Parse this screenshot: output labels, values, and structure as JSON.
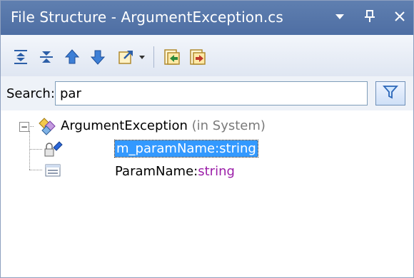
{
  "window": {
    "title": "File Structure - ArgumentException.cs",
    "controls": {
      "dropdown": "▾",
      "pin": "⊥",
      "close": "×"
    }
  },
  "toolbar": {
    "buttons": [
      {
        "name": "collapse-all-icon"
      },
      {
        "name": "expand-all-icon"
      },
      {
        "name": "move-up-icon"
      },
      {
        "name": "move-down-icon"
      },
      {
        "name": "navigate-icon"
      },
      {
        "name": "import-icon"
      },
      {
        "name": "export-icon"
      }
    ]
  },
  "search": {
    "label": "Search:",
    "value": "par"
  },
  "tree": {
    "root": {
      "name": "ArgumentException",
      "suffix": "(in System)"
    },
    "children": [
      {
        "name": "m_paramName",
        "sep": ":",
        "type": "string",
        "selected": true
      },
      {
        "name": "ParamName",
        "sep": ":",
        "type": "string",
        "selected": false
      }
    ]
  },
  "colors": {
    "title_bar": "#4e6ea3",
    "selection": "#3399ff",
    "type_keyword": "#9b1ea8",
    "suffix_gray": "#7a7a7a"
  }
}
